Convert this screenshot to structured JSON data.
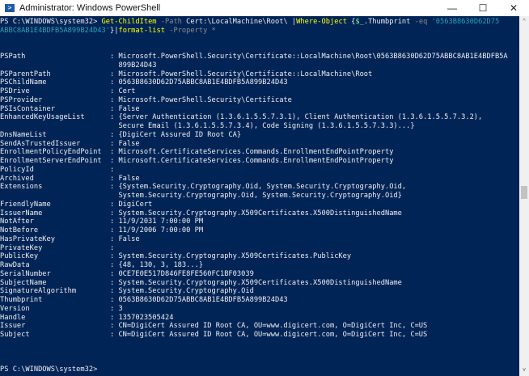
{
  "window": {
    "title": "Administrator: Windows PowerShell",
    "icon": "powershell-icon",
    "minimize": "—",
    "maximize": "☐",
    "close": "✕"
  },
  "command": {
    "prompt": "PS C:\\WINDOWS\\system32> ",
    "cmdlet1": "Get-ChildItem",
    "param1": " -Path",
    "arg1": " Cert:\\LocalMachine\\Root\\ ",
    "pipe1": "|",
    "cmdlet2": "Where-Object",
    "brace_open": " {",
    "var": "$_",
    "prop": ".Thumbprint",
    "op": " -eq ",
    "string": "'0563B8630D62D75ABBC8AB1E4BDFB5A899B24D43'",
    "brace_close": "}",
    "pipe2": "|",
    "cmdlet3": "format-list",
    "param2": " -Property *"
  },
  "output": [
    "",
    "",
    "PSPath                    : Microsoft.PowerShell.Security\\Certificate::LocalMachine\\Root\\0563B8630D62D75ABBC8AB1E4BDFB5A",
    "                            899B24D43",
    "PSParentPath              : Microsoft.PowerShell.Security\\Certificate::LocalMachine\\Root",
    "PSChildName               : 0563B8630D62D75ABBC8AB1E4BDFB5A899B24D43",
    "PSDrive                   : Cert",
    "PSProvider                : Microsoft.PowerShell.Security\\Certificate",
    "PSIsContainer             : False",
    "EnhancedKeyUsageList      : {Server Authentication (1.3.6.1.5.5.7.3.1), Client Authentication (1.3.6.1.5.5.7.3.2),",
    "                            Secure Email (1.3.6.1.5.5.7.3.4), Code Signing (1.3.6.1.5.5.7.3.3)...}",
    "DnsNameList               : {DigiCert Assured ID Root CA}",
    "SendAsTrustedIssuer       : False",
    "EnrollmentPolicyEndPoint  : Microsoft.CertificateServices.Commands.EnrollmentEndPointProperty",
    "EnrollmentServerEndPoint  : Microsoft.CertificateServices.Commands.EnrollmentEndPointProperty",
    "PolicyId                  :",
    "Archived                  : False",
    "Extensions                : {System.Security.Cryptography.Oid, System.Security.Cryptography.Oid,",
    "                            System.Security.Cryptography.Oid, System.Security.Cryptography.Oid}",
    "FriendlyName              : DigiCert",
    "IssuerName                : System.Security.Cryptography.X509Certificates.X500DistinguishedName",
    "NotAfter                  : 11/9/2031 7:00:00 PM",
    "NotBefore                 : 11/9/2006 7:00:00 PM",
    "HasPrivateKey             : False",
    "PrivateKey                :",
    "PublicKey                 : System.Security.Cryptography.X509Certificates.PublicKey",
    "RawData                   : {48, 130, 3, 183...}",
    "SerialNumber              : 0CE7E0E517D846FE8FE560FC1BF03039",
    "SubjectName               : System.Security.Cryptography.X509Certificates.X500DistinguishedName",
    "SignatureAlgorithm        : System.Security.Cryptography.Oid",
    "Thumbprint                : 0563B8630D62D75ABBC8AB1E4BDFB5A899B24D43",
    "Version                   : 3",
    "Handle                    : 1357023505424",
    "Issuer                    : CN=DigiCert Assured ID Root CA, OU=www.digicert.com, O=DigiCert Inc, C=US",
    "Subject                   : CN=DigiCert Assured ID Root CA, OU=www.digicert.com, O=DigiCert Inc, C=US",
    "",
    "",
    "",
    "PS C:\\WINDOWS\\system32>"
  ],
  "scrollbar": {
    "up": "^",
    "down": "v",
    "position": 0.45
  }
}
